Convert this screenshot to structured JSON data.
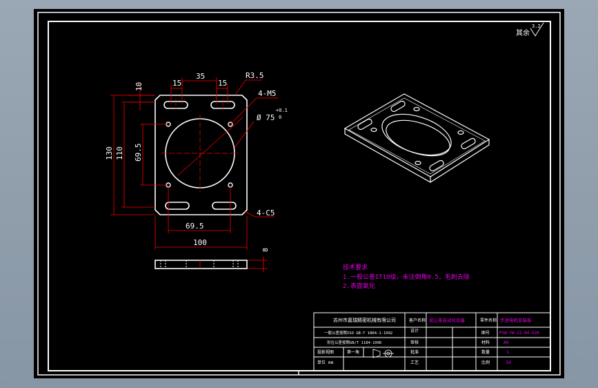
{
  "roughness": {
    "label": "其余",
    "value": "3.2"
  },
  "dims": {
    "d_top_10": "10",
    "d_15_left": "15",
    "d_35": "35",
    "d_15_right": "15",
    "radius": "R3.5",
    "holes": "4-M5",
    "bore_main": "Ø 75",
    "bore_tol_upper": "+0.1",
    "bore_tol_lower": "0",
    "h_130": "130",
    "h_110": "110",
    "h_695": "69.5",
    "w_695": "69.5",
    "w_100": "100",
    "chamfer": "4-C5",
    "thickness": "8"
  },
  "notes": {
    "title": "技术要求",
    "line1": "1.一般公差IT10级，未注倒角0.5，毛刺去除",
    "line2": "2.表面氧化"
  },
  "title_block": {
    "company": "苏州市嘉瑞精密机械有限公司",
    "std1": "一般公差按照ISO GB-T 1804-1-1992",
    "std2": "形位公差按照GB/T 1184-1996",
    "proj_label": "投影视图",
    "sheet_text": "第一角",
    "unit_label": "单位",
    "unit_value": "mm",
    "row_design": "设计",
    "row_check": "审核",
    "row_approve": "批准",
    "row_process": "工艺",
    "customer_label": "客户名称",
    "customer_value": "昆山某自动化设备",
    "part_name_label": "零件名称",
    "part_name_value": "步进电机安装板",
    "drawing_no_label": "图号",
    "drawing_no_value": "PSW-YW-22-04-020",
    "material_label": "材料",
    "material_value": "AO",
    "qty_label": "数量",
    "qty_value": "1",
    "scale_label": "比例",
    "scale_value": "3d"
  }
}
